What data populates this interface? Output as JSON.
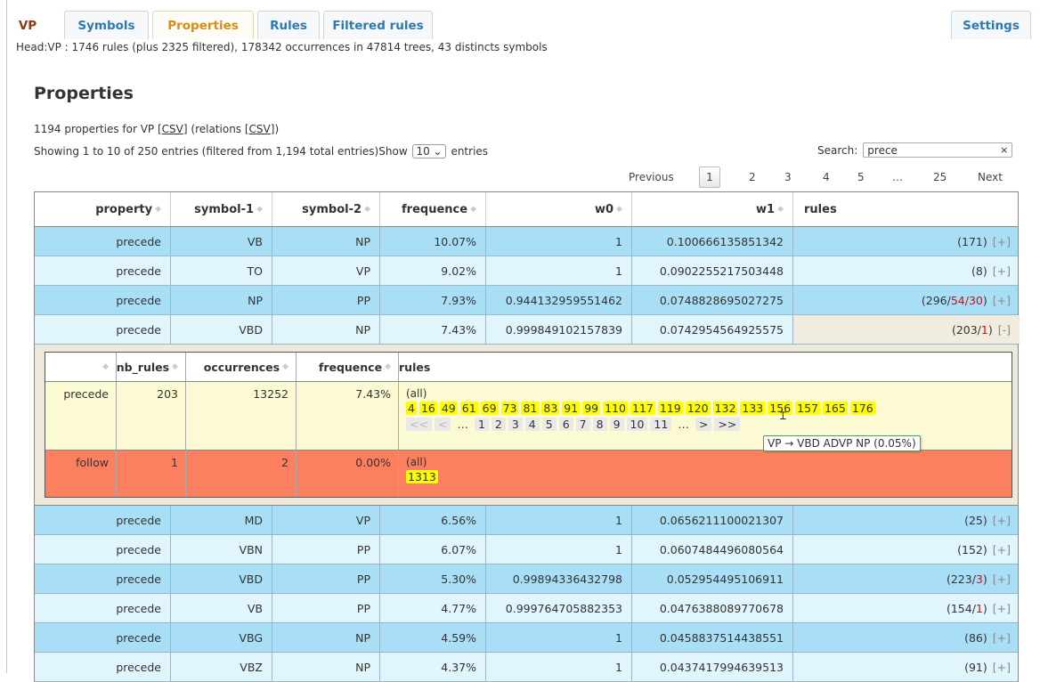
{
  "tabs": [
    {
      "label": "VP"
    },
    {
      "label": "Symbols"
    },
    {
      "label": "Properties"
    },
    {
      "label": "Rules"
    },
    {
      "label": "Filtered rules"
    }
  ],
  "settings_label": "Settings",
  "headline": "Head:VP : 1746 rules (plus 2325 filtered), 178342 occurrences in 47814 trees, 43 distincts symbols",
  "page_title": "Properties",
  "count_line": {
    "prefix": "1194 properties for VP [",
    "csv1": "CSV",
    "mid": "] (relations [",
    "csv2": "CSV",
    "suffix": "])"
  },
  "showing": {
    "text": "Showing 1 to 10 of 250 entries (filtered from 1,194 total entries)",
    "show_label": "Show",
    "show_value": "10 ⌄",
    "entries_label": "entries"
  },
  "search": {
    "label": "Search:",
    "value": "prece",
    "clear": "×"
  },
  "pager": {
    "previous": "Previous",
    "pages": [
      "1",
      "2",
      "3",
      "4",
      "5",
      "…",
      "25"
    ],
    "next": "Next"
  },
  "columns": [
    "property",
    "symbol-1",
    "symbol-2",
    "frequence",
    "w0",
    "w1",
    "rules"
  ],
  "rows_top": [
    {
      "property": "precede",
      "s1": "VB",
      "s2": "NP",
      "freq": "10.07%",
      "w0": "1",
      "w1": "0.100666135851342",
      "rules_pre": "(171",
      "rules_red": "",
      "rules_post": ")",
      "toggle": "[+]"
    },
    {
      "property": "precede",
      "s1": "TO",
      "s2": "VP",
      "freq": "9.02%",
      "w0": "1",
      "w1": "0.0902255217503448",
      "rules_pre": "(8",
      "rules_red": "",
      "rules_post": ")",
      "toggle": "[+]"
    },
    {
      "property": "precede",
      "s1": "NP",
      "s2": "PP",
      "freq": "7.93%",
      "w0": "0.944132959551462",
      "w1": "0.0748828695027275",
      "rules_pre": "(296/",
      "rules_red": "54/30",
      "rules_post": ")",
      "toggle": "[+]"
    },
    {
      "property": "precede",
      "s1": "VBD",
      "s2": "NP",
      "freq": "7.43%",
      "w0": "0.999849102157839",
      "w1": "0.0742954564925575",
      "rules_pre": "(203/",
      "rules_red": "1",
      "rules_post": ")",
      "toggle": "[-]"
    }
  ],
  "sub": {
    "columns": [
      "nb_rules",
      "occurrences",
      "frequence",
      "rules"
    ],
    "row1": {
      "name": "precede",
      "nb_rules": "203",
      "occurrences": "13252",
      "freq": "7.43%",
      "all": "(all)",
      "chips": [
        "4",
        "16",
        "49",
        "61",
        "69",
        "73",
        "81",
        "83",
        "91",
        "99",
        "110",
        "117",
        "119",
        "120",
        "132",
        "133",
        "156",
        "157",
        "165",
        "176"
      ],
      "pager": [
        "<<",
        "<",
        "…",
        "1",
        "2",
        "3",
        "4",
        "5",
        "6",
        "7",
        "8",
        "9",
        "10",
        "11",
        "…",
        ">",
        ">>"
      ]
    },
    "row2": {
      "name": "follow",
      "nb_rules": "1",
      "occurrences": "2",
      "freq": "0.00%",
      "all": "(all)",
      "chips": [
        "1313"
      ]
    },
    "tooltip": "VP → VBD ADVP NP (0.05%)"
  },
  "rows_bottom": [
    {
      "property": "precede",
      "s1": "MD",
      "s2": "VP",
      "freq": "6.56%",
      "w0": "1",
      "w1": "0.0656211100021307",
      "rules_pre": "(25",
      "rules_red": "",
      "rules_post": ")",
      "toggle": "[+]"
    },
    {
      "property": "precede",
      "s1": "VBN",
      "s2": "PP",
      "freq": "6.07%",
      "w0": "1",
      "w1": "0.0607484496080564",
      "rules_pre": "(152",
      "rules_red": "",
      "rules_post": ")",
      "toggle": "[+]"
    },
    {
      "property": "precede",
      "s1": "VBD",
      "s2": "PP",
      "freq": "5.30%",
      "w0": "0.99894336432798",
      "w1": "0.052954495106911",
      "rules_pre": "(223/",
      "rules_red": "3",
      "rules_post": ")",
      "toggle": "[+]"
    },
    {
      "property": "precede",
      "s1": "VB",
      "s2": "PP",
      "freq": "4.77%",
      "w0": "0.999764705882353",
      "w1": "0.0476388089770678",
      "rules_pre": "(154/",
      "rules_red": "1",
      "rules_post": ")",
      "toggle": "[+]"
    },
    {
      "property": "precede",
      "s1": "VBG",
      "s2": "NP",
      "freq": "4.59%",
      "w0": "1",
      "w1": "0.0458837514438551",
      "rules_pre": "(86",
      "rules_red": "",
      "rules_post": ")",
      "toggle": "[+]"
    },
    {
      "property": "precede",
      "s1": "VBZ",
      "s2": "NP",
      "freq": "4.37%",
      "w0": "1",
      "w1": "0.0437417994639513",
      "rules_pre": "(91",
      "rules_red": "",
      "rules_post": ")",
      "toggle": "[+]"
    }
  ]
}
